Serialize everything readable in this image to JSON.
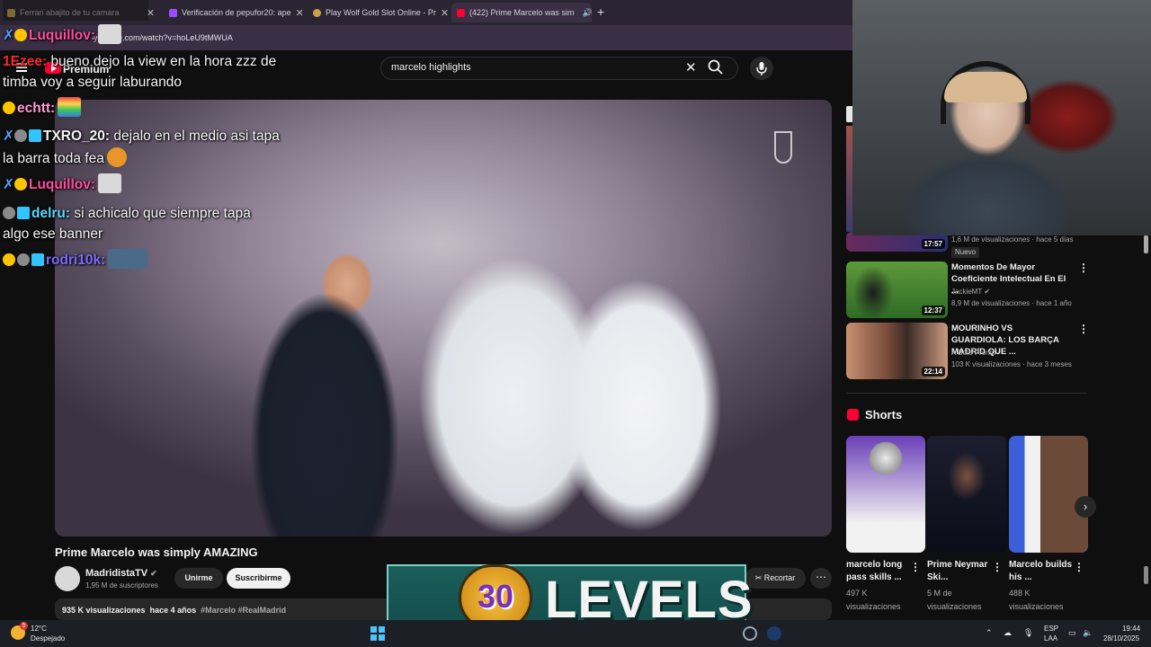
{
  "browser": {
    "tabs": [
      {
        "label": "Ferrari abajito de tu camara",
        "color": "#e8c04a"
      },
      {
        "label": "Verificación de pepufor20: ape",
        "color": "#9a4dff"
      },
      {
        "label": "Play Wolf Gold Slot Online - Pr",
        "color": "#c9a24a"
      },
      {
        "label": "(422) Prime Marcelo was sim",
        "color": "#ff0033"
      }
    ],
    "url": "youtube.com/watch?v=hoLeU9tMWUA"
  },
  "youtube": {
    "logo_suffix": "Premium",
    "search_value": "marcelo highlights",
    "video_title": "Prime Marcelo was simply AMAZING",
    "channel_name": "MadridistaTV",
    "subscribers": "1,95 M de suscriptores",
    "join_label": "Unirme",
    "subscribe_label": "Suscribirme",
    "clip_label": "Recortar",
    "description": {
      "views": "935 K visualizaciones",
      "age": "hace 4 años",
      "tags": "#Marcelo #RealMadrid"
    },
    "recommended": [
      {
        "title": "",
        "channel": "",
        "meta": "1,6 M de visualizaciones · hace 5 días",
        "duration": "17:57",
        "badge": "Nuevo"
      },
      {
        "title": "Momentos De Mayor Coeficiente Intelectual En El ...",
        "channel": "JackieMT",
        "verified": true,
        "meta": "8,9 M de visualizaciones · hace 1 año",
        "duration": "12:37"
      },
      {
        "title": "MOURINHO VS GUARDIOLA: LOS BARÇA MADRID QUE ...",
        "channel": "A Bote Pronto",
        "meta": "103 K visualizaciones · hace 3 meses",
        "duration": "22:14"
      }
    ],
    "shorts_heading": "Shorts",
    "shorts": [
      {
        "title": "marcelo long pass skills ...",
        "views": "497 K visualizaciones"
      },
      {
        "title": "Prime Neymar Ski...",
        "views": "5 M de visualizaciones"
      },
      {
        "title": "Marcelo builds his ...",
        "views": "488 K visualizaciones"
      }
    ]
  },
  "chat": [
    {
      "user": "Luquillov:",
      "color": "#ff4d9a",
      "text": ""
    },
    {
      "user": "1Ezee:",
      "color": "#ff2a2a",
      "text": "bueno dejo la view en la hora zzz de"
    },
    {
      "user": "",
      "color": "#ffffff",
      "text": "timba voy a seguir laburando"
    },
    {
      "user": "echtt:",
      "color": "#ff9ad5",
      "text": ""
    },
    {
      "user": "TXRO_20:",
      "color": "#ffffff",
      "text": "dejalo en el medio asi tapa"
    },
    {
      "user": "",
      "color": "#ffffff",
      "text": "la barra toda fea"
    },
    {
      "user": "Luquillov:",
      "color": "#ff4d9a",
      "text": ""
    },
    {
      "user": "delru:",
      "color": "#59d5ff",
      "text": "si achicalo que siempre tapa"
    },
    {
      "user": "",
      "color": "#ffffff",
      "text": "algo ese banner"
    },
    {
      "user": "rodri10k:",
      "color": "#7d6bff",
      "text": ""
    }
  ],
  "overlay": {
    "number": "30",
    "text": "LEVELS"
  },
  "taskbar": {
    "weather_temp": "12°C",
    "weather_desc": "Despejado",
    "lang_top": "ESP",
    "lang_bottom": "LAA",
    "time": "19:44",
    "date": "28/10/2025",
    "weather_badge": "5"
  }
}
